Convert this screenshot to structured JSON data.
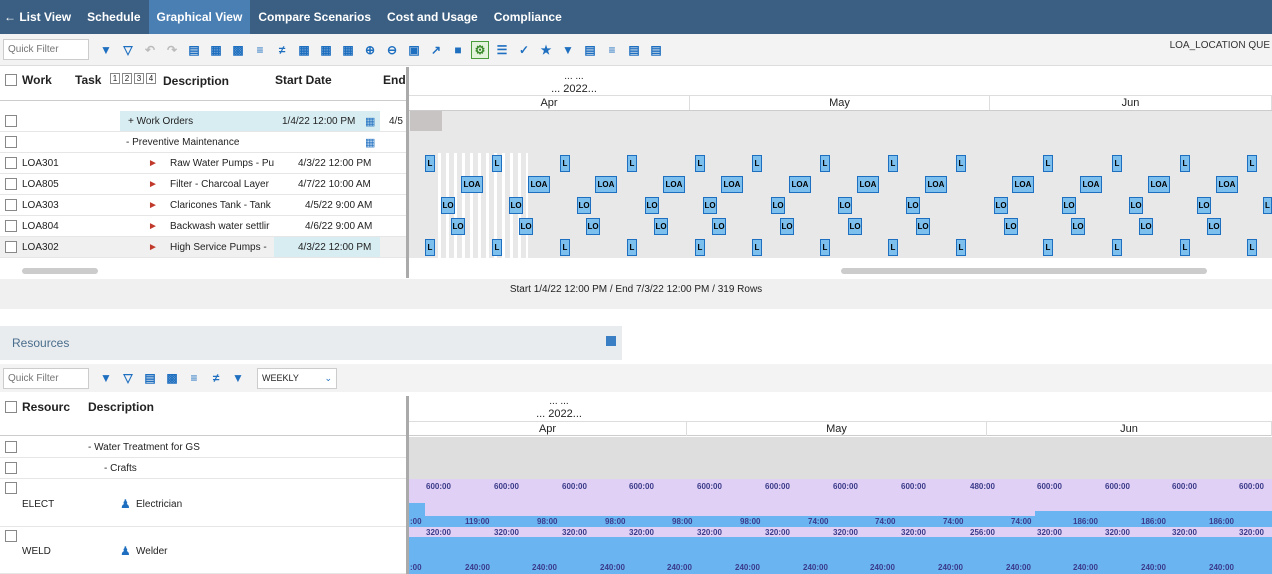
{
  "tabs": {
    "back_label": "List View",
    "items": [
      "Schedule",
      "Graphical View",
      "Compare Scenarios",
      "Cost and Usage",
      "Compliance"
    ]
  },
  "toolbar": {
    "quick_filter_placeholder": "Quick Filter",
    "right_label": "LOA_LOCATION QUE"
  },
  "grid": {
    "columns": [
      "Work",
      "Task",
      "Description",
      "Start Date",
      "End"
    ],
    "level_buttons": [
      "1",
      "2",
      "3",
      "4"
    ],
    "rows": [
      {
        "work": "",
        "description": "+ Work Orders",
        "start": "1/4/22 12:00 PM",
        "end": "4/5"
      },
      {
        "work": "",
        "description": "- Preventive Maintenance",
        "start": "",
        "end": ""
      },
      {
        "work": "LOA301",
        "description": "Raw Water Pumps - Pu",
        "start": "4/3/22 12:00 PM",
        "end": ""
      },
      {
        "work": "LOA805",
        "description": "Filter - Charcoal Layer",
        "start": "4/7/22 10:00 AM",
        "end": ""
      },
      {
        "work": "LOA303",
        "description": "Claricones Tank - Tank",
        "start": "4/5/22 9:00 AM",
        "end": ""
      },
      {
        "work": "LOA804",
        "description": "Backwash water settlir",
        "start": "4/6/22 9:00 AM",
        "end": ""
      },
      {
        "work": "LOA302",
        "description": "High Service Pumps -",
        "start": "4/3/22 12:00 PM",
        "end": ""
      }
    ]
  },
  "gantt": {
    "top_dots": "... ...",
    "year": "... 2022...",
    "months": [
      "Apr",
      "May",
      "Jun"
    ],
    "bar_labels": {
      "short": "L",
      "loa": "LOA",
      "lo": "LO"
    }
  },
  "status_text": "Start 1/4/22 12:00 PM / End 7/3/22 12:00 PM / 319 Rows",
  "resources": {
    "title": "Resources",
    "quick_filter_placeholder": "Quick Filter",
    "period": "WEEKLY",
    "columns": [
      "Resourc",
      "Description"
    ],
    "groups": [
      "- Water Treatment for GS",
      "- Crafts"
    ],
    "rows": [
      {
        "code": "ELECT",
        "name": "Electrician",
        "capacity": [
          "600:00",
          "600:00",
          "600:00",
          "600:00",
          "600:00",
          "600:00",
          "600:00",
          "600:00",
          "480:00",
          "600:00",
          "600:00",
          "600:00",
          "600:00"
        ],
        "usage": [
          ":00",
          "119:00",
          "98:00",
          "98:00",
          "98:00",
          "98:00",
          "74:00",
          "74:00",
          "74:00",
          "74:00",
          "186:00",
          "186:00",
          "186:00"
        ]
      },
      {
        "code": "WELD",
        "name": "Welder",
        "capacity": [
          "320:00",
          "320:00",
          "320:00",
          "320:00",
          "320:00",
          "320:00",
          "320:00",
          "320:00",
          "256:00",
          "320:00",
          "320:00",
          "320:00",
          "320:00"
        ],
        "usage": [
          ":00",
          "240:00",
          "240:00",
          "240:00",
          "240:00",
          "240:00",
          "240:00",
          "240:00",
          "240:00",
          "240:00",
          "240:00",
          "240:00",
          "240:00"
        ]
      }
    ],
    "top_dots": "... ...",
    "year": "... 2022...",
    "months": [
      "Apr",
      "May",
      "Jun"
    ]
  },
  "colors": {
    "tabbar": "#3b5f82",
    "active_tab": "#4a7fb3",
    "bar": "#7dc0ee",
    "capacity": "#e0d0f5",
    "usage": "#6ab4f2"
  }
}
